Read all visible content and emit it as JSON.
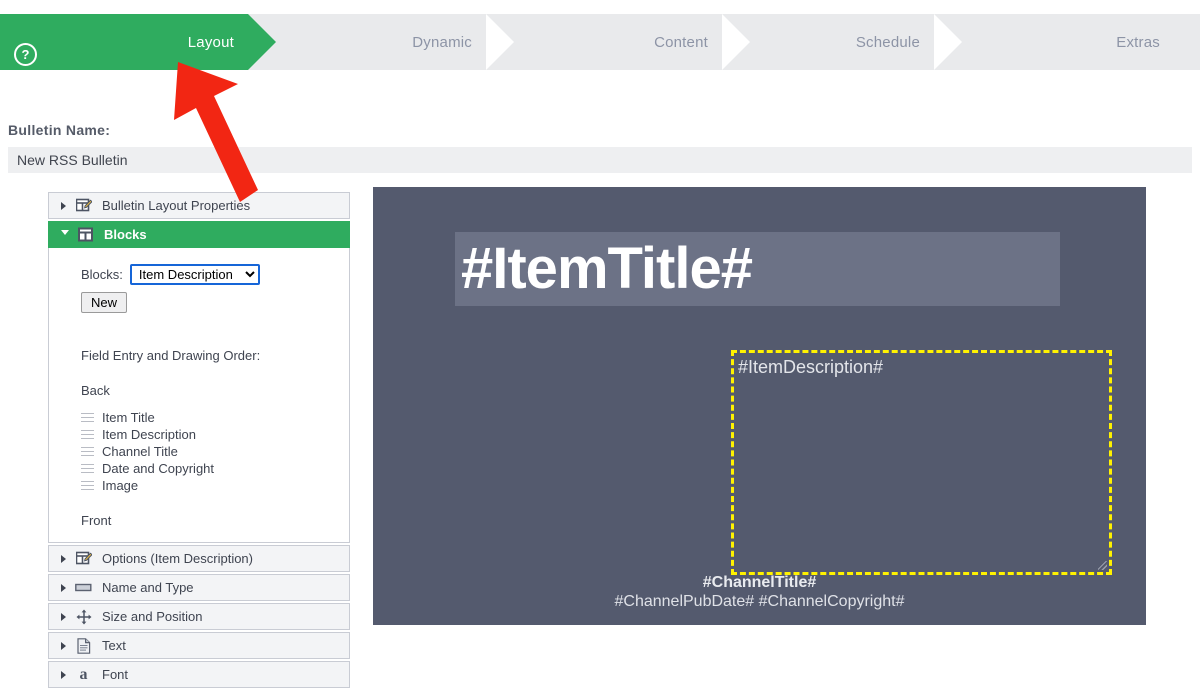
{
  "wizard": {
    "help_icon": "?",
    "steps": [
      {
        "label": "Layout",
        "state": "active"
      },
      {
        "label": "Dynamic",
        "state": "inactive"
      },
      {
        "label": "Content",
        "state": "inactive"
      },
      {
        "label": "Schedule",
        "state": "inactive"
      },
      {
        "label": "Extras",
        "state": "inactive"
      }
    ],
    "active_color": "#2fac5f",
    "inactive_color": "#e9eaec"
  },
  "bulletin": {
    "label": "Bulletin Name:",
    "value": "New RSS Bulletin",
    "placeholder": "Bulletin Name"
  },
  "sidebar": {
    "panels": [
      {
        "label": "Bulletin Layout Properties",
        "icon": "layout-properties-icon",
        "open": false
      },
      {
        "label": "Blocks",
        "icon": "blocks-icon",
        "open": true
      },
      {
        "label": "Options (Item Description)",
        "icon": "options-icon",
        "open": false
      },
      {
        "label": "Name and Type",
        "icon": "name-type-icon",
        "open": false
      },
      {
        "label": "Size and Position",
        "icon": "move-arrows-icon",
        "open": false
      },
      {
        "label": "Text",
        "icon": "text-document-icon",
        "open": false
      },
      {
        "label": "Font",
        "icon": "font-a-icon",
        "open": false
      }
    ],
    "blocks_panel": {
      "select_label": "Blocks:",
      "selected_block": "Item Description",
      "options": [
        "Item Description"
      ],
      "new_button": "New",
      "order_title": "Field Entry and Drawing Order:",
      "back_label": "Back",
      "front_label": "Front",
      "fields": [
        "Item Title",
        "Item Description",
        "Channel Title",
        "Date and Copyright",
        "Image"
      ]
    }
  },
  "preview": {
    "item_title": "#ItemTitle#",
    "item_description": "#ItemDescription#",
    "channel_title": "#ChannelTitle#",
    "channel_meta": "#ChannelPubDate# #ChannelCopyright#",
    "canvas_color": "#545a6e",
    "title_band_color": "#6c7286",
    "selection_color": "#fff200"
  },
  "annotation": {
    "arrow_color": "#f22613",
    "points_to": "Layout"
  }
}
